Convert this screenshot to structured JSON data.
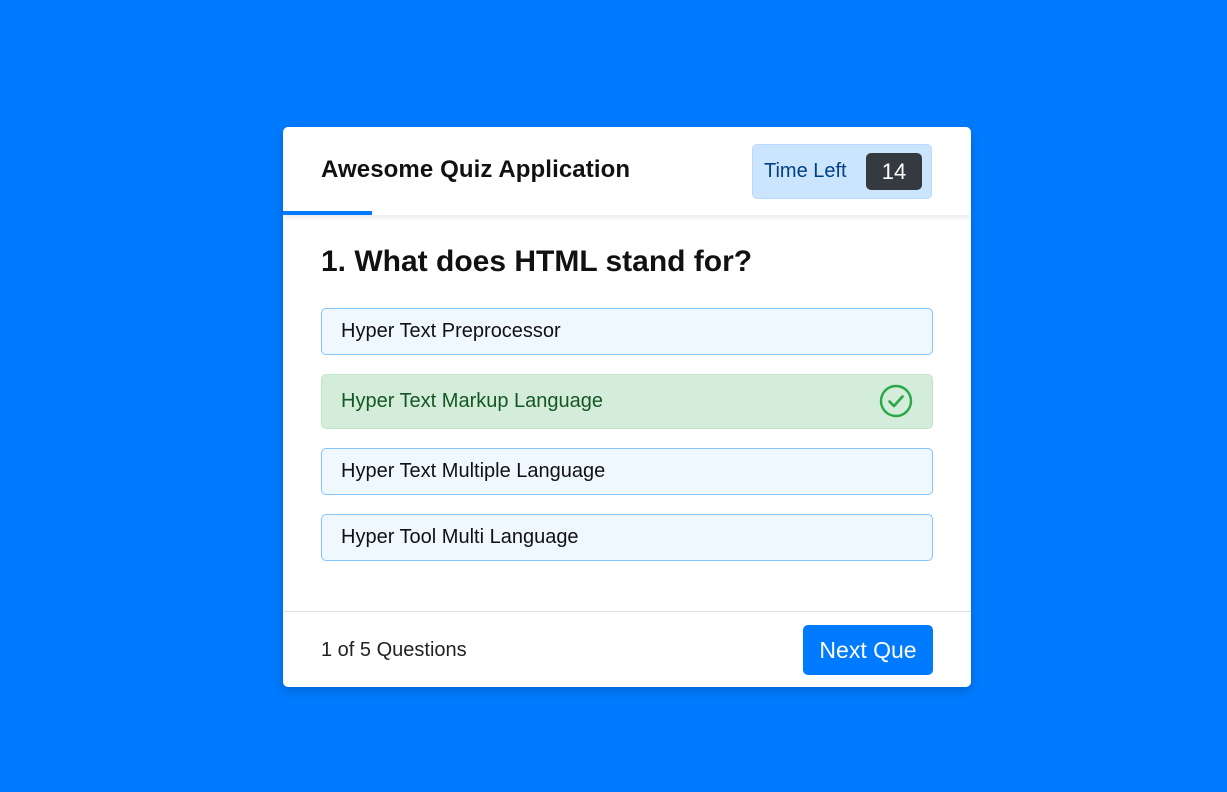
{
  "header": {
    "title": "Awesome Quiz Application",
    "timer_label": "Time Left",
    "timer_seconds": "14",
    "time_progress_fraction": 0.13
  },
  "question": {
    "text": "1. What does HTML stand for?"
  },
  "options": [
    {
      "label": "Hyper Text Preprocessor",
      "state": "default"
    },
    {
      "label": "Hyper Text Markup Language",
      "state": "correct",
      "icon": "check-circle-icon"
    },
    {
      "label": "Hyper Text Multiple Language",
      "state": "default"
    },
    {
      "label": "Hyper Tool Multi Language",
      "state": "default"
    }
  ],
  "footer": {
    "progress_text": "1 of 5 Questions",
    "next_button_label": "Next Que"
  },
  "colors": {
    "background": "#007bff",
    "accent": "#007bff",
    "correct_bg": "#d4edda",
    "correct_text": "#155724",
    "correct_icon": "#28a745",
    "option_bg": "#f0f8ff",
    "option_border": "#84c5fe",
    "timer_bg": "#cce5ff",
    "timer_badge": "#343a40"
  }
}
